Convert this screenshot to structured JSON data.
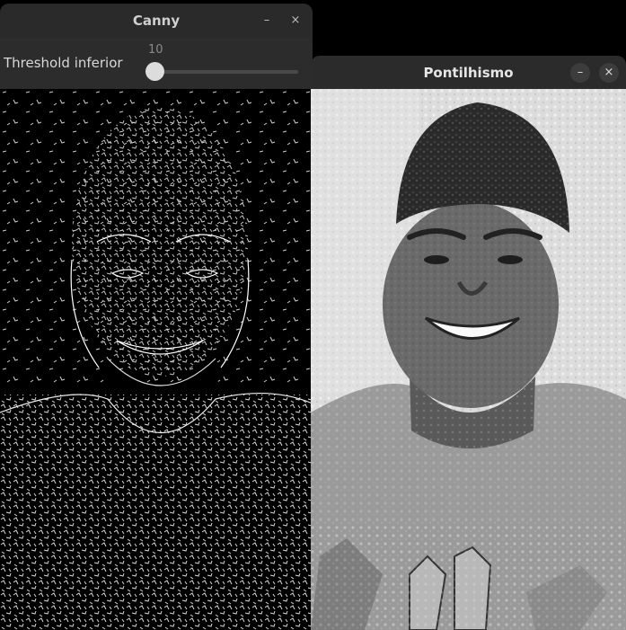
{
  "windows": {
    "canny": {
      "title": "Canny",
      "trackbar": {
        "label": "Threshold inferior",
        "value": "10"
      }
    },
    "pontilhismo": {
      "title": "Pontilhismo"
    }
  },
  "controls": {
    "minimize_glyph": "–",
    "close_glyph": "×"
  },
  "colors": {
    "titlebar": "#2b2b2b",
    "trackbar_bg": "#2c2c2c",
    "slider_handle": "#dcdcdc"
  }
}
